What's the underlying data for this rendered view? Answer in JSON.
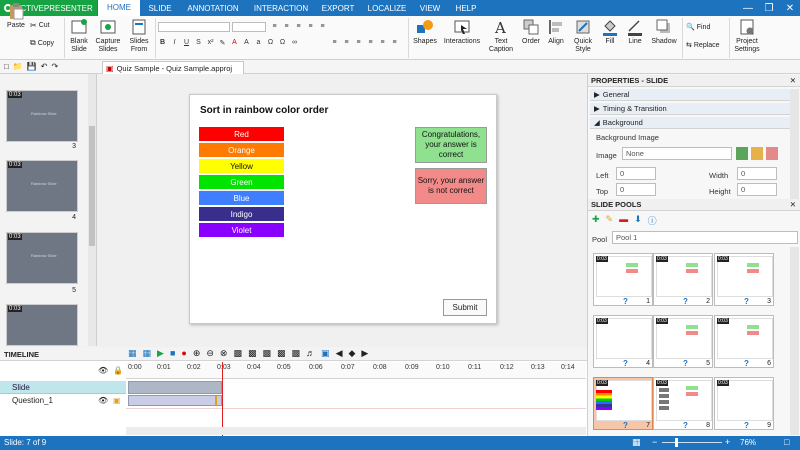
{
  "app": {
    "name": "ACTIVEPRESENTER",
    "menu_tabs": [
      "HOME",
      "SLIDE",
      "ANNOTATION",
      "INTERACTION",
      "EXPORT",
      "LOCALIZE",
      "VIEW",
      "HELP"
    ]
  },
  "ribbon": {
    "paste": "Paste",
    "cut": "Cut",
    "copy": "Copy",
    "blank_slide": "Blank\nSlide",
    "capture_slides": "Capture\nSlides",
    "slides_from": "Slides\nFrom",
    "shapes": "Shapes",
    "interactions": "Interactions",
    "text_caption": "Text\nCaption",
    "order": "Order",
    "align": "Align",
    "quick_style": "Quick\nStyle",
    "fill": "Fill",
    "line": "Line",
    "shadow": "Shadow",
    "find": "Find",
    "replace": "Replace",
    "project_settings": "Project\nSettings"
  },
  "document": {
    "tab_title": "Quiz Sample - Quiz Sample.approj"
  },
  "left_panel": {
    "thumbnails": [
      {
        "timer": "0:03",
        "title": "Rainbow Slide",
        "number": "3"
      },
      {
        "timer": "0:03",
        "title": "Rainbow Slide",
        "number": "4"
      },
      {
        "timer": "0:03",
        "title": "Rainbow Slide",
        "number": "5"
      },
      {
        "timer": "0:03",
        "title": "",
        "number": ""
      }
    ]
  },
  "slide": {
    "title": "Sort in rainbow color order",
    "items": [
      {
        "label": "Red",
        "color": "#ff0000"
      },
      {
        "label": "Orange",
        "color": "#ff7a00"
      },
      {
        "label": "Yellow",
        "color": "#ffff00"
      },
      {
        "label": "Green",
        "color": "#00e400"
      },
      {
        "label": "Blue",
        "color": "#3f7fff"
      },
      {
        "label": "Indigo",
        "color": "#3a2e8c"
      },
      {
        "label": "Violet",
        "color": "#8a00ff"
      }
    ],
    "correct_msg": "Congratulations, your answer is correct",
    "incorrect_msg": "Sorry, your answer is not correct",
    "submit": "Submit"
  },
  "properties": {
    "header": "PROPERTIES - SLIDE",
    "sections": [
      "General",
      "Timing & Transition",
      "Background"
    ],
    "background_image_label": "Background Image",
    "image_label": "Image",
    "image_value": "None",
    "left_label": "Left",
    "left_value": "0",
    "width_label": "Width",
    "width_value": "0",
    "top_label": "Top",
    "top_value": "0",
    "height_label": "Height",
    "height_value": "0"
  },
  "slide_pools": {
    "header": "SLIDE POOLS",
    "pool_label": "Pool",
    "pool_value": "Pool 1",
    "thumbs": [
      {
        "timer": "0:03",
        "number": "1"
      },
      {
        "timer": "0:03",
        "number": "2"
      },
      {
        "timer": "0:03",
        "number": "3"
      },
      {
        "timer": "0:03",
        "number": "4"
      },
      {
        "timer": "0:03",
        "number": "5"
      },
      {
        "timer": "0:03",
        "number": "6"
      },
      {
        "timer": "0:03",
        "number": "7"
      },
      {
        "timer": "0:03",
        "number": "8"
      },
      {
        "timer": "0:03",
        "number": "9"
      }
    ]
  },
  "timeline": {
    "title": "TIMELINE",
    "ruler": [
      "0:00",
      "0:01",
      "0:02",
      "0:03",
      "0:04",
      "0:05",
      "0:06",
      "0:07",
      "0:08",
      "0:09",
      "0:10",
      "0:11",
      "0:12",
      "0:13",
      "0:14"
    ],
    "tracks": [
      "Slide",
      "Question_1"
    ]
  },
  "status": {
    "slide_counter": "Slide: 7 of 9",
    "zoom": "76%"
  },
  "colors": {
    "brand_blue": "#1e73be",
    "app_green": "#17a344",
    "correct_bg": "#8fe08f",
    "incorrect_bg": "#f38a8a",
    "selected_pool": "#f7c6a8"
  }
}
